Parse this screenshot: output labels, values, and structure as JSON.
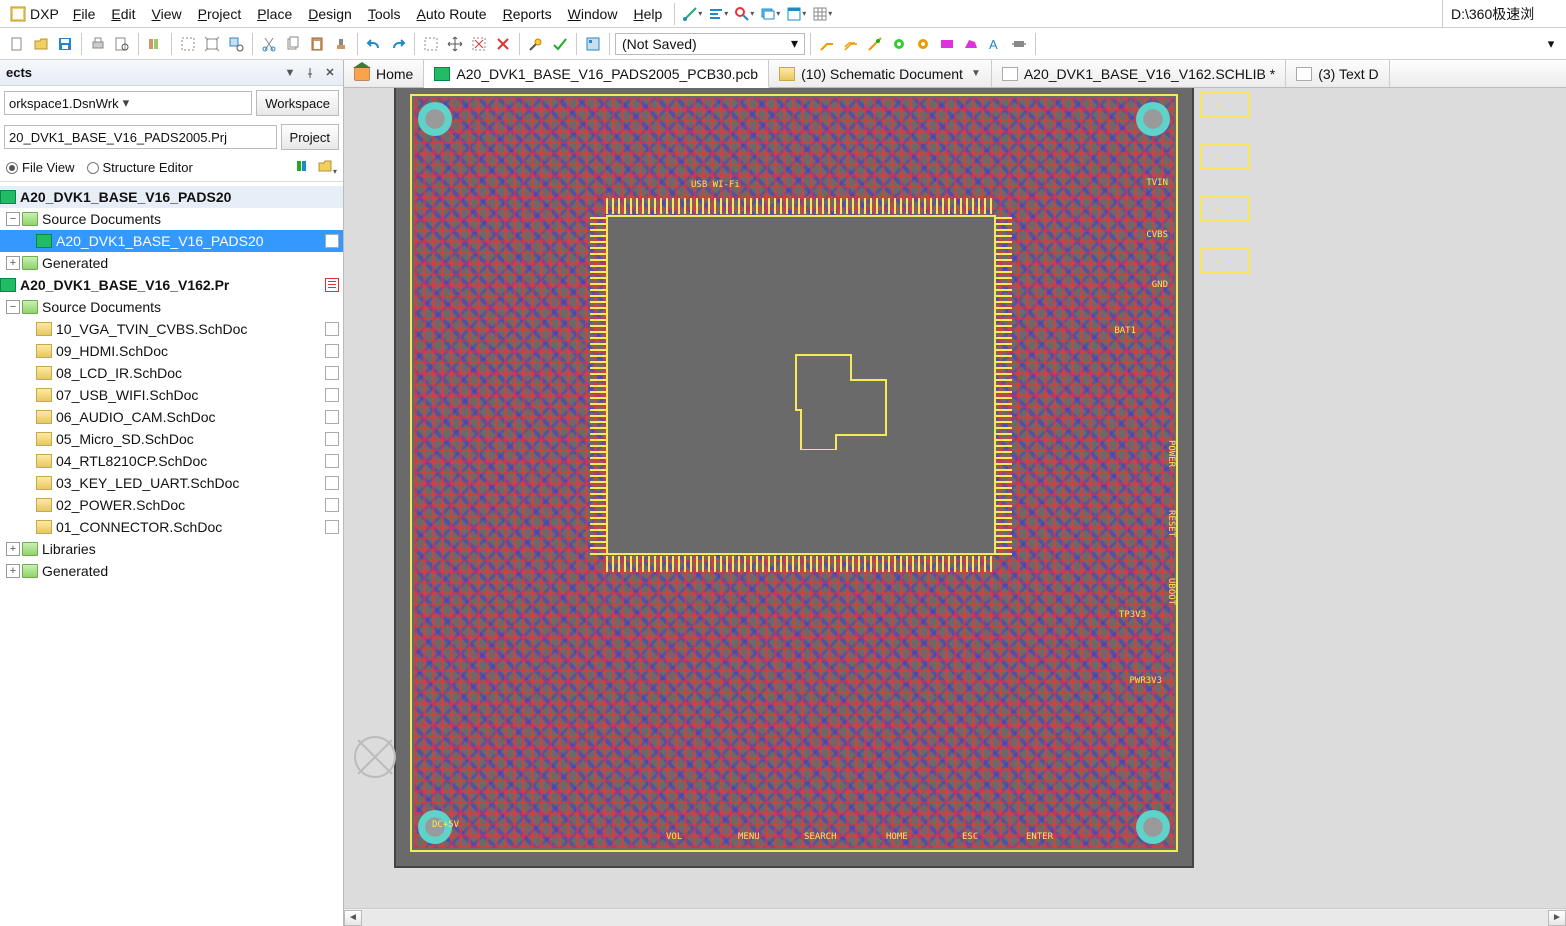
{
  "menu": {
    "dxp": "DXP",
    "items": [
      {
        "l": "F",
        "t": "ile"
      },
      {
        "l": "E",
        "t": "dit"
      },
      {
        "l": "V",
        "t": "iew"
      },
      {
        "l": "P",
        "t": "roject"
      },
      {
        "l": "P",
        "t": "lace",
        "pre": ""
      },
      {
        "l": "D",
        "t": "esign"
      },
      {
        "l": "T",
        "t": "ools"
      },
      {
        "l": "A",
        "t": "uto Route"
      },
      {
        "l": "R",
        "t": "eports"
      },
      {
        "l": "W",
        "t": "indow"
      },
      {
        "l": "H",
        "t": "elp"
      }
    ],
    "path": "D:\\360极速浏"
  },
  "toolbar": {
    "combo": "(Not Saved)"
  },
  "panel": {
    "title": "ects",
    "workspace_value": "orkspace1.DsnWrk",
    "workspace_btn": "Workspace",
    "project_value": "20_DVK1_BASE_V16_PADS2005.Prj",
    "project_btn": "Project",
    "file_view": "File View",
    "structure_editor": "Structure Editor"
  },
  "tree": {
    "proj1": "A20_DVK1_BASE_V16_PADS20",
    "src1": "Source Documents",
    "pcbdoc": "A20_DVK1_BASE_V16_PADS20",
    "gen1": "Generated",
    "proj2": "A20_DVK1_BASE_V16_V162.Pr",
    "src2": "Source Documents",
    "docs": [
      "10_VGA_TVIN_CVBS.SchDoc",
      "09_HDMI.SchDoc",
      "08_LCD_IR.SchDoc",
      "07_USB_WIFI.SchDoc",
      "06_AUDIO_CAM.SchDoc",
      "05_Micro_SD.SchDoc",
      "04_RTL8210CP.SchDoc",
      "03_KEY_LED_UART.SchDoc",
      "02_POWER.SchDoc",
      "01_CONNECTOR.SchDoc"
    ],
    "libs": "Libraries",
    "gen2": "Generated"
  },
  "tabs": {
    "home": "Home",
    "pcb": "A20_DVK1_BASE_V16_PADS2005_PCB30.pcb",
    "sch": "(10) Schematic Document",
    "lib": "A20_DVK1_BASE_V16_V162.SCHLIB *",
    "txt": "(3) Text D"
  },
  "silk": {
    "usb": "USB WI-Fi",
    "cvbs": "CVBS",
    "gnd": "GND",
    "tvin": "TVIN",
    "bat": "BAT1",
    "power": "POWER",
    "reset": "RESET",
    "uboot": "UBOOT",
    "tp": "TP3V3",
    "pwr3": "PWR3V3",
    "dc": "DC+5V",
    "vol": "VOL",
    "menu": "MENU",
    "search": "SEARCH",
    "home": "HOME",
    "esc": "ESC",
    "enter": "ENTER"
  }
}
